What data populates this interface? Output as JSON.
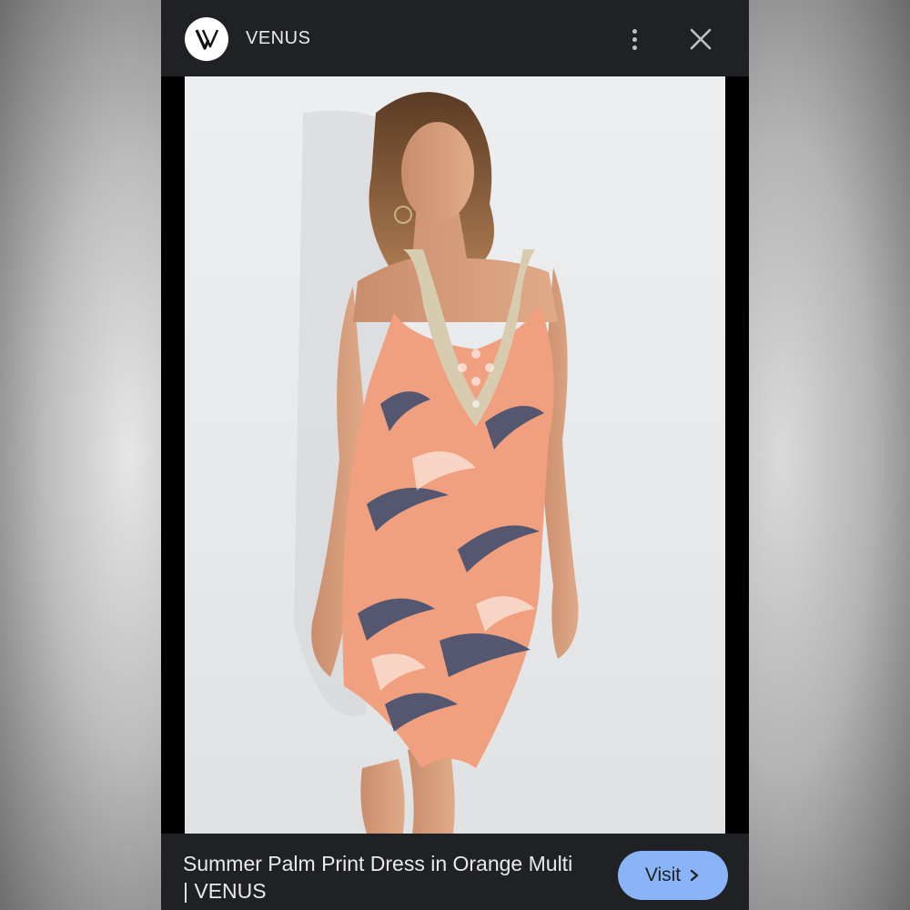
{
  "header": {
    "logo_icon": "venus-logo-icon",
    "site_name": "VENUS",
    "menu_icon": "more-vertical-icon",
    "close_icon": "close-icon"
  },
  "image": {
    "subject_icon": "product-photo"
  },
  "footer": {
    "caption": "Summer Palm Print Dress in Orange Multi | VENUS",
    "visit_label": "Visit",
    "visit_icon": "chevron-right-icon"
  },
  "colors": {
    "sheet_bg": "#202124",
    "text": "#e8eaed",
    "accent": "#8ab4f8",
    "dress_orange": "#f0a07e",
    "dress_navy": "#3a4a6e",
    "lace": "#d8ccb0"
  }
}
